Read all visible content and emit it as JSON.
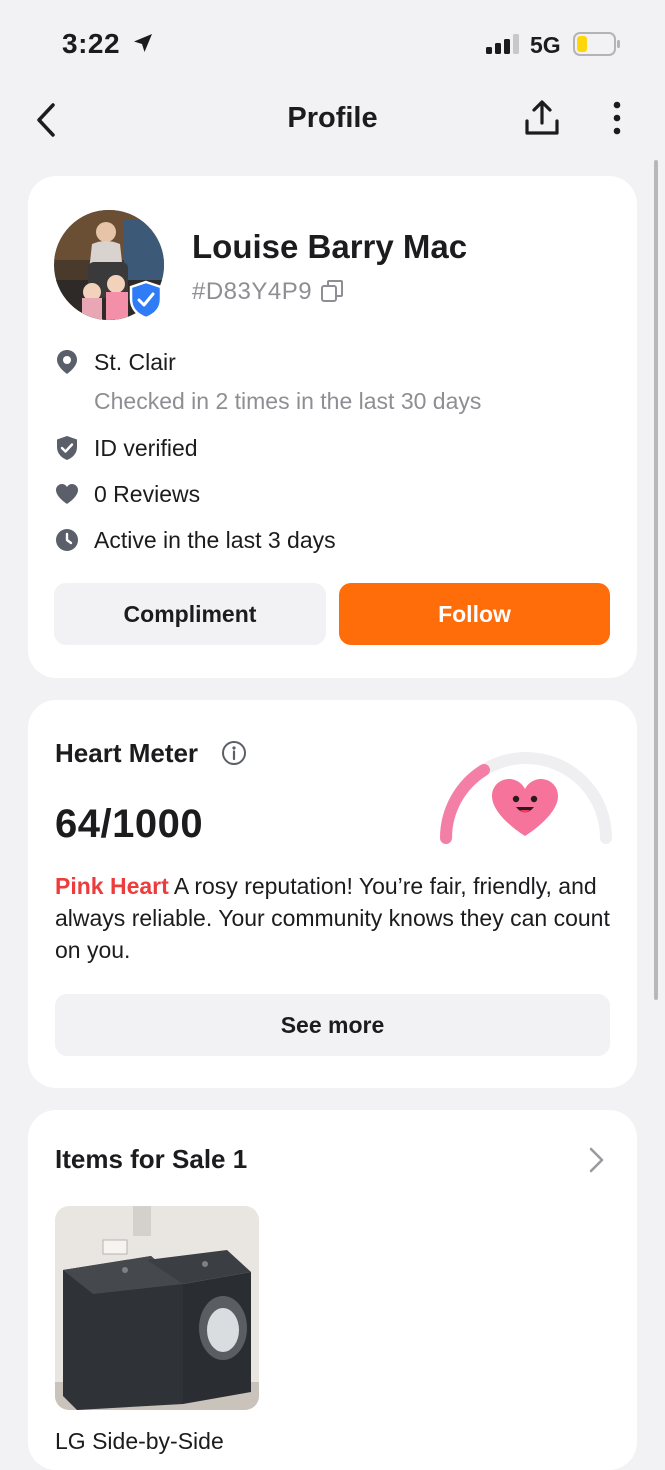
{
  "status_bar": {
    "time": "3:22",
    "network": "5G"
  },
  "nav": {
    "title": "Profile"
  },
  "profile": {
    "name": "Louise Barry Mac",
    "code": "#D83Y4P9",
    "location": "St. Clair",
    "checkins": "Checked in 2 times in the last 30 days",
    "id_status": "ID verified",
    "reviews": "0 Reviews",
    "activity": "Active in the last 3 days",
    "compliment_label": "Compliment",
    "follow_label": "Follow"
  },
  "heart_meter": {
    "title": "Heart Meter",
    "score": "64/1000",
    "tier": "Pink Heart",
    "description": " A rosy reputation! You’re fair, friendly, and always reliable. Your community knows they can count on you.",
    "see_more_label": "See more"
  },
  "sale": {
    "title": "Items for Sale 1",
    "items": [
      {
        "label": "LG Side-by-Side"
      }
    ]
  },
  "colors": {
    "accent": "#ff6c0a",
    "tier": "#ec3c3c",
    "gauge": "#f47fa6",
    "verified": "#2f7cf6"
  }
}
